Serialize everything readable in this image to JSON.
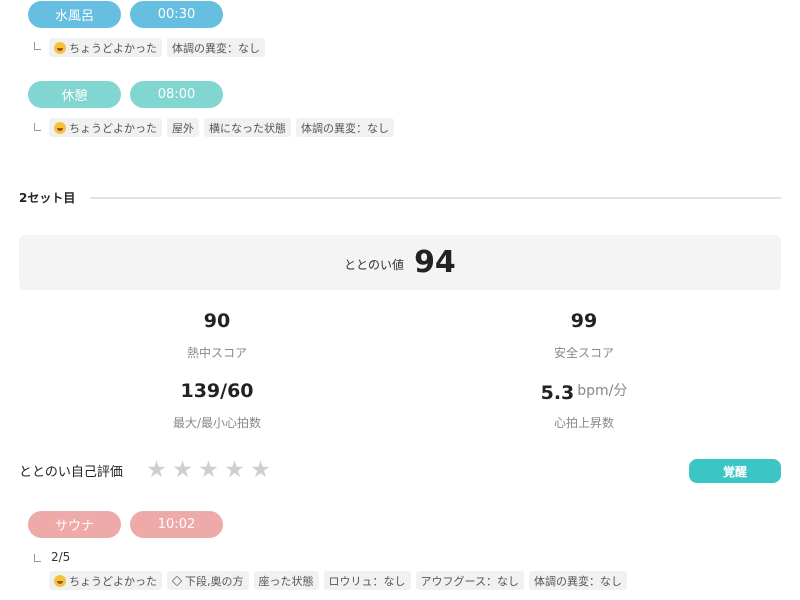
{
  "set1": {
    "bath": {
      "type_label": "水風呂",
      "time": "00:30",
      "tags": [
        "ちょうどよかった",
        "体調の異変：なし"
      ]
    },
    "rest": {
      "type_label": "休憩",
      "time": "08:00",
      "tags": [
        "ちょうどよかった",
        "屋外",
        "横になった状態",
        "体調の異変：なし"
      ]
    }
  },
  "set2": {
    "title": "2セット目",
    "totonoi": {
      "label": "ととのい値",
      "value": "94"
    },
    "stats": {
      "heat_score": {
        "value": "90",
        "label": "熱中スコア"
      },
      "safety_score": {
        "value": "99",
        "label": "安全スコア"
      },
      "heart_rate": {
        "value": "139/60",
        "label": "最大/最小心拍数"
      },
      "hr_rise": {
        "value": "5.3",
        "unit": "bpm/分",
        "label": "心拍上昇数"
      }
    },
    "self_eval": {
      "label": "ととのい自己評価",
      "rating": 0,
      "max": 5
    },
    "memo_button": "覚醒",
    "sauna": {
      "type_label": "サウナ",
      "time": "10:02",
      "sub_count": "2/5",
      "tags": [
        "ちょうどよかった",
        "下段,奥の方",
        "座った状態",
        "ロウリュ：なし",
        "アウフグース：なし",
        "体調の異変：なし"
      ]
    }
  },
  "colors": {
    "bath_pill": "#66bfe0",
    "rest_pill": "#82d6d2",
    "sauna_pill": "#eeaaa8",
    "accent_button": "#3cc5c5",
    "star_empty": "#cfcfcf"
  },
  "icons": {
    "mood": "grinning-face-icon",
    "position": "layers-icon",
    "rating": "star-icon"
  }
}
